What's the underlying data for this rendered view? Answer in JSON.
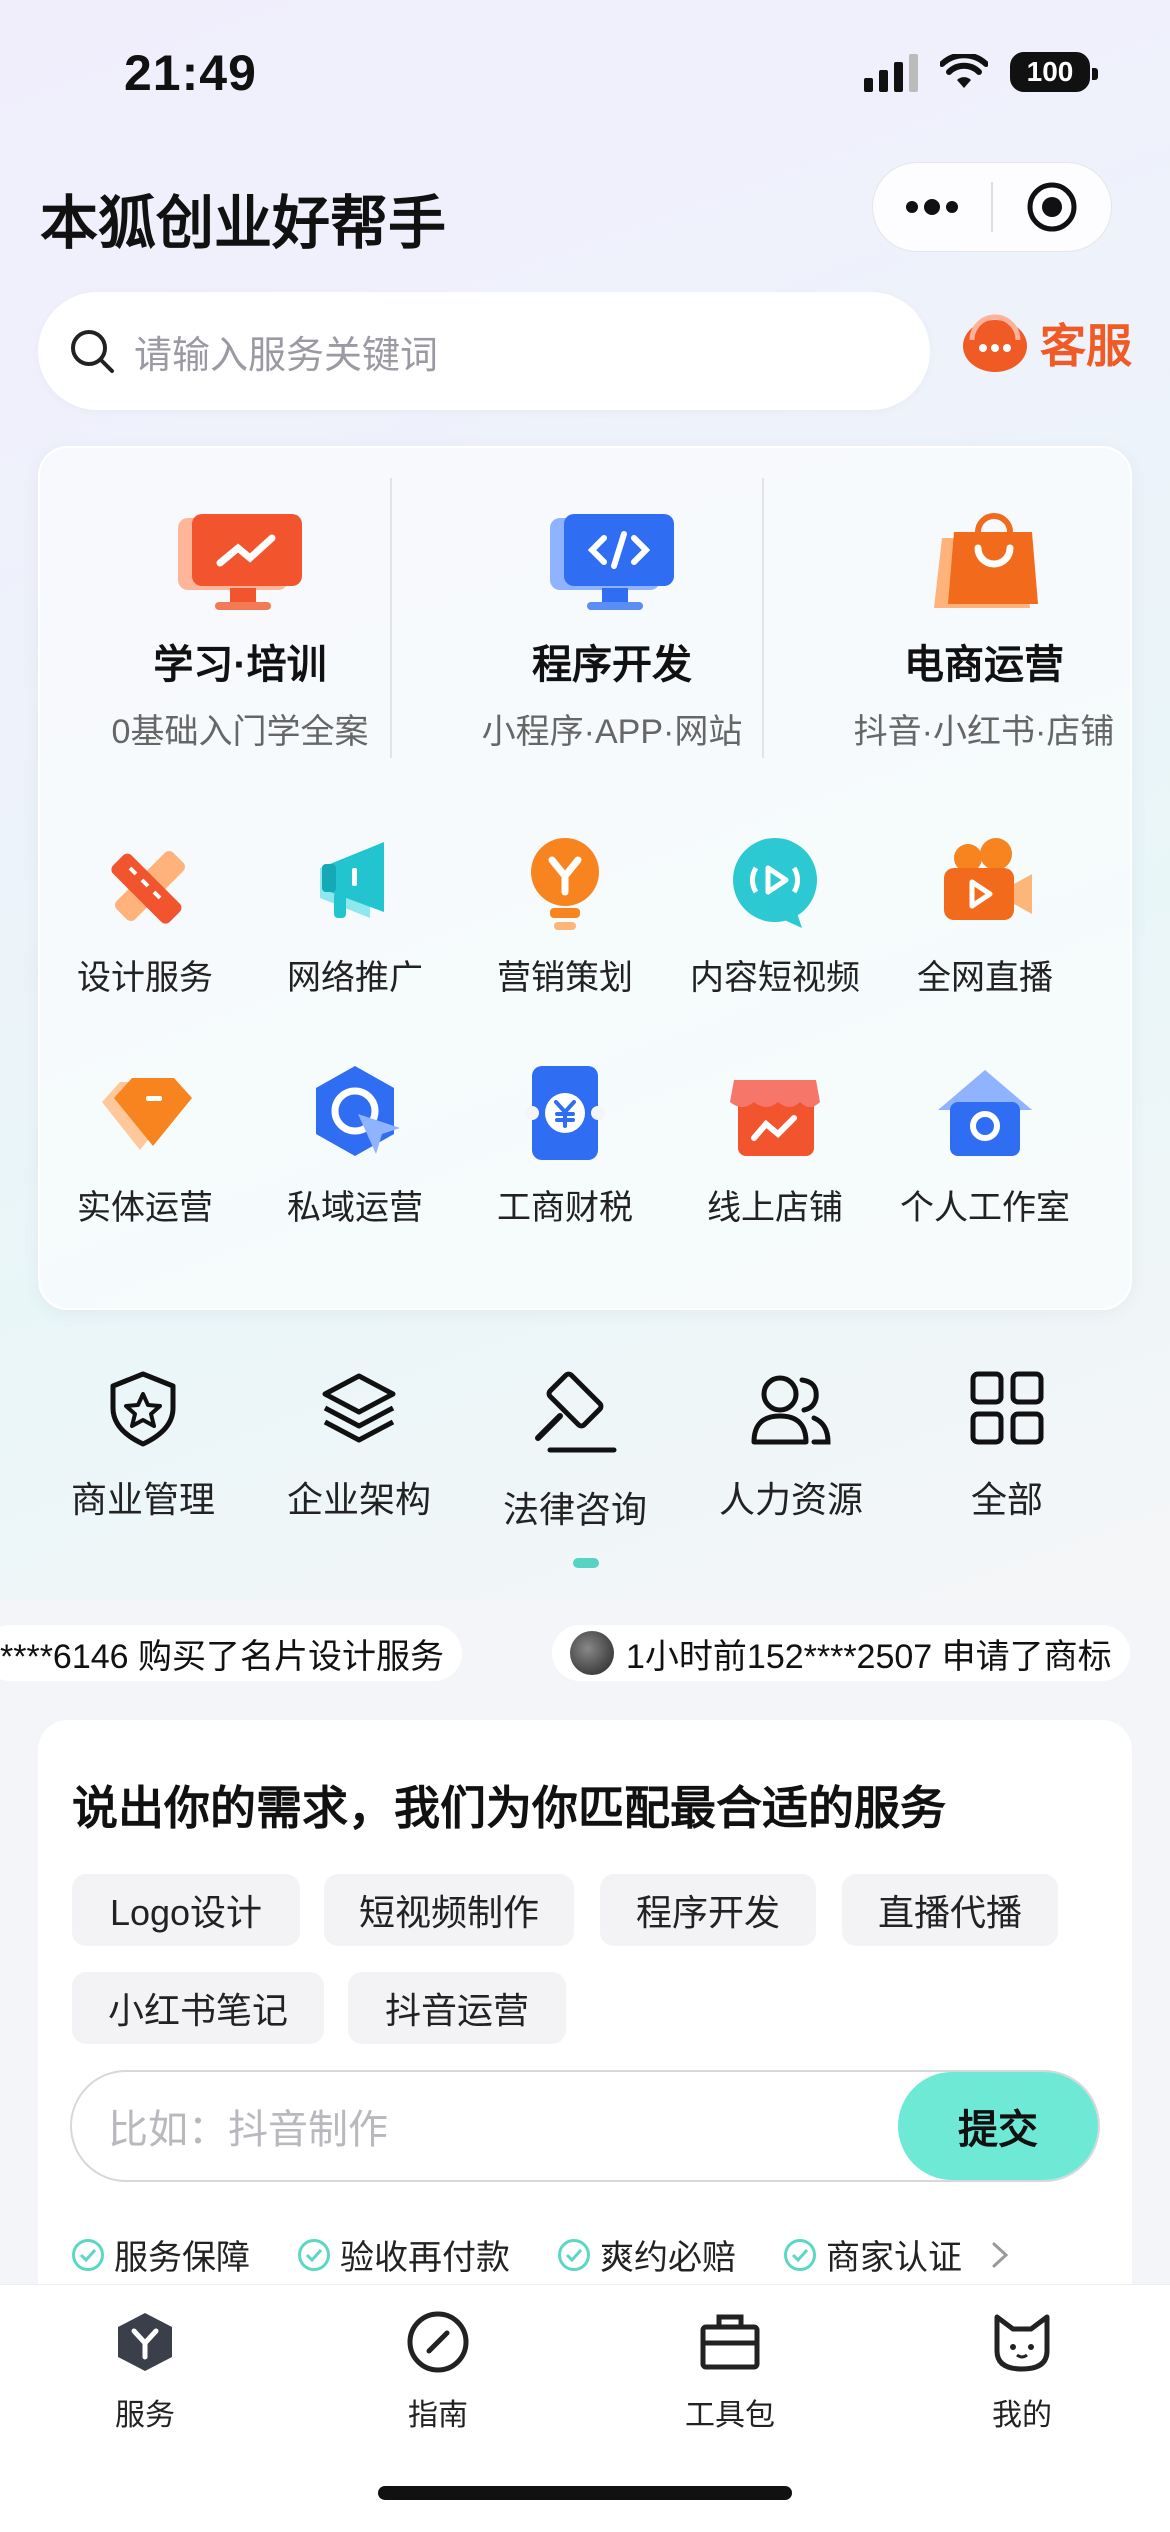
{
  "status_bar": {
    "time": "21:49",
    "battery": "100"
  },
  "header": {
    "title": "本狐创业好帮手"
  },
  "search": {
    "placeholder": "请输入服务关键词",
    "service_label": "客服"
  },
  "featured": [
    {
      "title": "学习·培训",
      "subtitle": "0基础入门学全案",
      "icon": "trend-screen-icon"
    },
    {
      "title": "程序开发",
      "subtitle": "小程序·APP·网站",
      "icon": "code-screen-icon"
    },
    {
      "title": "电商运营",
      "subtitle": "抖音·小红书·店铺",
      "icon": "shopping-bag-icon"
    }
  ],
  "grid": [
    {
      "label": "设计服务",
      "icon": "ruler-pencil-icon"
    },
    {
      "label": "网络推广",
      "icon": "megaphone-icon"
    },
    {
      "label": "营销策划",
      "icon": "lightbulb-icon"
    },
    {
      "label": "内容短视频",
      "icon": "video-bubble-icon"
    },
    {
      "label": "全网直播",
      "icon": "camera-icon"
    },
    {
      "label": "实体运营",
      "icon": "diamond-icon"
    },
    {
      "label": "私域运营",
      "icon": "target-arrow-icon"
    },
    {
      "label": "工商财税",
      "icon": "yen-ticket-icon"
    },
    {
      "label": "线上店铺",
      "icon": "storefront-icon"
    },
    {
      "label": "个人工作室",
      "icon": "house-icon"
    }
  ],
  "secondary": [
    {
      "label": "商业管理",
      "icon": "shield-star-icon"
    },
    {
      "label": "企业架构",
      "icon": "layers-icon"
    },
    {
      "label": "法律咨询",
      "icon": "gavel-icon"
    },
    {
      "label": "人力资源",
      "icon": "people-icon"
    },
    {
      "label": "全部",
      "icon": "grid-icon"
    }
  ],
  "ticker": [
    "****6146 购买了名片设计服务",
    "1小时前152****2507 申请了商标"
  ],
  "needs": {
    "title": "说出你的需求，我们为你匹配最合适的服务",
    "chips": [
      "Logo设计",
      "短视频制作",
      "程序开发",
      "直播代播",
      "小红书笔记",
      "抖音运营"
    ],
    "placeholder": "比如：抖音制作",
    "submit": "提交",
    "guarantees": [
      "服务保障",
      "验收再付款",
      "爽约必赔",
      "商家认证"
    ]
  },
  "tabbar": [
    {
      "label": "服务",
      "icon": "hexagon-y-icon"
    },
    {
      "label": "指南",
      "icon": "compass-icon"
    },
    {
      "label": "工具包",
      "icon": "toolbox-icon"
    },
    {
      "label": "我的",
      "icon": "cat-face-icon"
    }
  ],
  "colors": {
    "accent": "#6ee9d5",
    "service_orange": "#f05a24"
  }
}
